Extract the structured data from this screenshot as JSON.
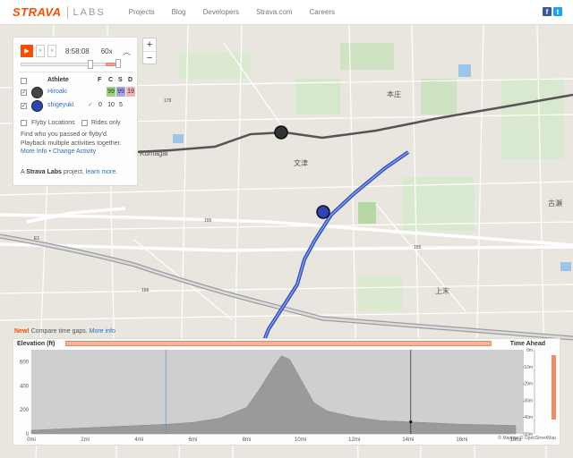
{
  "header": {
    "brand": "STRAVA",
    "sub": "LABS",
    "nav": [
      "Projects",
      "Blog",
      "Developers",
      "Strava.com",
      "Careers"
    ],
    "facebook": "f",
    "twitter": "t"
  },
  "playback": {
    "time": "8:58:08",
    "speed": "60x",
    "play_glyph": "▶",
    "prev_glyph": "«",
    "next_glyph": "»",
    "collapse_glyph": "︿"
  },
  "table": {
    "headers": {
      "athlete": "Athlete",
      "f": "F",
      "c": "C",
      "s": "S",
      "d": "D"
    },
    "athletes": [
      {
        "name": "Hiroaki",
        "check": "✓",
        "mark": "",
        "f": "",
        "c": "99",
        "s": "99",
        "d": "19"
      },
      {
        "name": "shigeyuki",
        "check": "✓",
        "mark": "✓",
        "f": "0",
        "c": "10",
        "s": "5",
        "d": ""
      }
    ]
  },
  "options": {
    "flyby": "Flyby Locations",
    "rides_only": "Rides only"
  },
  "desc": {
    "line1": "Find who you passed or flyby'd.",
    "line2": "Playback multiple activities together.",
    "more": "More Info",
    "bullet": "•",
    "change": "Change Activity"
  },
  "credit": {
    "prefix": "A",
    "name": "Strava Labs",
    "mid": "project,",
    "link": "learn more."
  },
  "zoom": {
    "in": "+",
    "out": "−"
  },
  "map_labels": {
    "town1": "本庄",
    "town2": "文津",
    "town3": "上末",
    "town4": "古瀬",
    "town5": "Kumagai",
    "r1": "179",
    "r2": "155",
    "r3": "E1",
    "r4": "156",
    "r5": "155"
  },
  "elevation": {
    "new_label": "New!",
    "new_text": "Compare time gaps.",
    "new_link": "More info",
    "title": "Elevation (ft)",
    "time_ahead": "Time Ahead",
    "y_ticks": [
      "600",
      "400",
      "200",
      "0"
    ],
    "x_ticks": [
      "0mi",
      "2mi",
      "4mi",
      "6mi",
      "8mi",
      "10mi",
      "12mi",
      "14mi",
      "16mi",
      "18mi"
    ],
    "r_ticks": [
      "0m",
      "-10m",
      "-20m",
      "-30m",
      "-40m",
      "-50m"
    ],
    "attribution": "© Mapbox © OpenStreetMap"
  },
  "chart_data": {
    "type": "area",
    "title": "",
    "xlabel": "",
    "ylabel": "Elevation (ft)",
    "xlim": [
      0,
      18.3
    ],
    "ylim": [
      0,
      700
    ],
    "x": [
      0,
      1,
      2,
      3,
      4,
      5,
      6,
      7,
      8,
      8.5,
      9,
      9.3,
      9.6,
      10,
      10.5,
      11,
      12,
      13,
      14,
      15,
      16,
      17,
      18
    ],
    "series": [
      {
        "values": [
          30,
          40,
          50,
          60,
          70,
          80,
          95,
          130,
          220,
          380,
          560,
          650,
          620,
          460,
          260,
          190,
          140,
          110,
          100,
          90,
          80,
          75,
          70
        ]
      }
    ],
    "marker_x": 14.1
  },
  "colors": {
    "brand": "#fc4c02",
    "link": "#2a6fbd",
    "route": "#4a6fd4",
    "track": "#555555"
  }
}
